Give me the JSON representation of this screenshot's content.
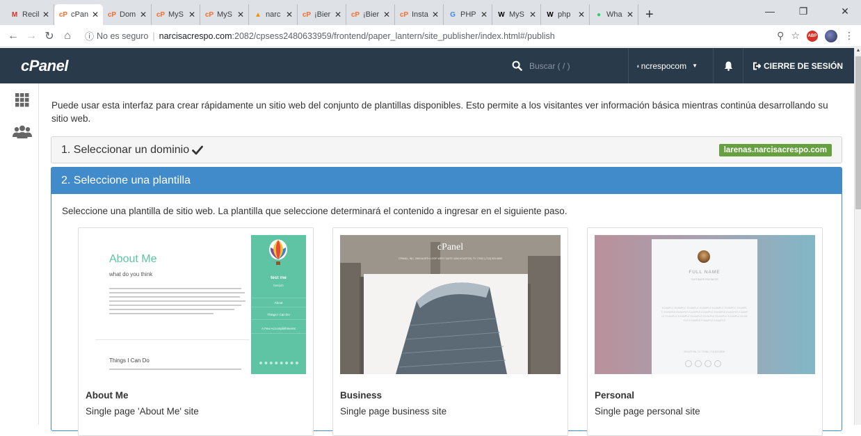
{
  "browser": {
    "tabs": [
      {
        "label": "Recil",
        "favicon": "gmail-icon",
        "color": "#d93025",
        "glyph": "M"
      },
      {
        "label": "cPan",
        "favicon": "cpanel-icon",
        "color": "#ff6c2c",
        "glyph": "cP"
      },
      {
        "label": "Dom",
        "favicon": "cpanel-icon",
        "color": "#ff6c2c",
        "glyph": "cP"
      },
      {
        "label": "MyS",
        "favicon": "cpanel-icon",
        "color": "#ff6c2c",
        "glyph": "cP"
      },
      {
        "label": "MyS",
        "favicon": "cpanel-icon",
        "color": "#ff6c2c",
        "glyph": "cP"
      },
      {
        "label": "narc",
        "favicon": "phpmyadmin-icon",
        "color": "#f29111",
        "glyph": "▲"
      },
      {
        "label": "¡Bier",
        "favicon": "cpanel-icon",
        "color": "#ff6c2c",
        "glyph": "cP"
      },
      {
        "label": "¡Bier",
        "favicon": "cpanel-icon",
        "color": "#ff6c2c",
        "glyph": "cP"
      },
      {
        "label": "Insta",
        "favicon": "cpanel-icon",
        "color": "#ff6c2c",
        "glyph": "cP"
      },
      {
        "label": "PHP",
        "favicon": "google-icon",
        "color": "#4285f4",
        "glyph": "G"
      },
      {
        "label": "MyS",
        "favicon": "wikipedia-icon",
        "color": "#000000",
        "glyph": "W"
      },
      {
        "label": "php",
        "favicon": "wikipedia-icon",
        "color": "#000000",
        "glyph": "W"
      },
      {
        "label": "Wha",
        "favicon": "whatsapp-icon",
        "color": "#25d366",
        "glyph": "●"
      }
    ],
    "new_tab": "+",
    "security": "No es seguro",
    "url_host": "narcisacrespo.com",
    "url_path": ":2082/cpsess2480633959/frontend/paper_lantern/site_publisher/index.html#/publish",
    "abp_label": "ABP"
  },
  "header": {
    "logo": "cPanel",
    "search_placeholder": "Buscar ( / )",
    "username": "ncrespocom",
    "logout": "CIERRE DE SESIÓN"
  },
  "main": {
    "intro": "Puede usar esta interfaz para crear rápidamente un sitio web del conjunto de plantillas disponibles. Esto permite a los visitantes ver información básica mientras continúa desarrollando su sitio web.",
    "step1_label": "1. Seleccionar un dominio",
    "domain": "larenas.narcisacrespo.com",
    "step2_label": "2. Seleccione una plantilla",
    "step2_desc": "Seleccione una plantilla de sitio web. La plantilla que seleccione determinará el contenido a ingresar en el siguiente paso."
  },
  "templates": [
    {
      "name": "About Me",
      "desc": "Single page 'About Me' site",
      "thumb": {
        "heading": "About Me",
        "sub": "what do you think",
        "things": "Things I Can Do",
        "side_name": "test me",
        "side_role": "bestjob",
        "side_link1": "About",
        "side_link2": "Things I Can Do",
        "side_link3": "A Few Accomplishments"
      }
    },
    {
      "name": "Business",
      "desc": "Single page business site",
      "thumb": {
        "brand": "cPanel",
        "address": "CPANEL, INC. 2550 NORTH LOOP WEST SUITE 4006 HOUSTON, TX 77092 | (713) 529-0800"
      }
    },
    {
      "name": "Personal",
      "desc": "Single page personal site",
      "thumb": {
        "name": "FULL NAME",
        "role": "SOFTWARE ENGINEER",
        "body": "EXAMPLE EXAMPLE EXAMPLE EXAMPLE EXAMPLE EXAMPLE EXAMPLE EXAMPLE EXAMPLE EXAMPLE EXAMPLE EXAMPLE EXAMPLE EXAMPLE EXAMPLE EXAMPLE EXAMPLE EXAMPLE EXAMPLE EXAMPLE EXAMPLE EXAMPLE EXAMPLE EXAMPLE",
        "footer": "HOUSTON, TX 77088 | 713.529.0800"
      }
    }
  ],
  "colors": {
    "header_bg": "#293a4a",
    "panel_blue": "#428bca",
    "badge_green": "#66a03f",
    "aboutme_green": "#5ec4a3"
  }
}
